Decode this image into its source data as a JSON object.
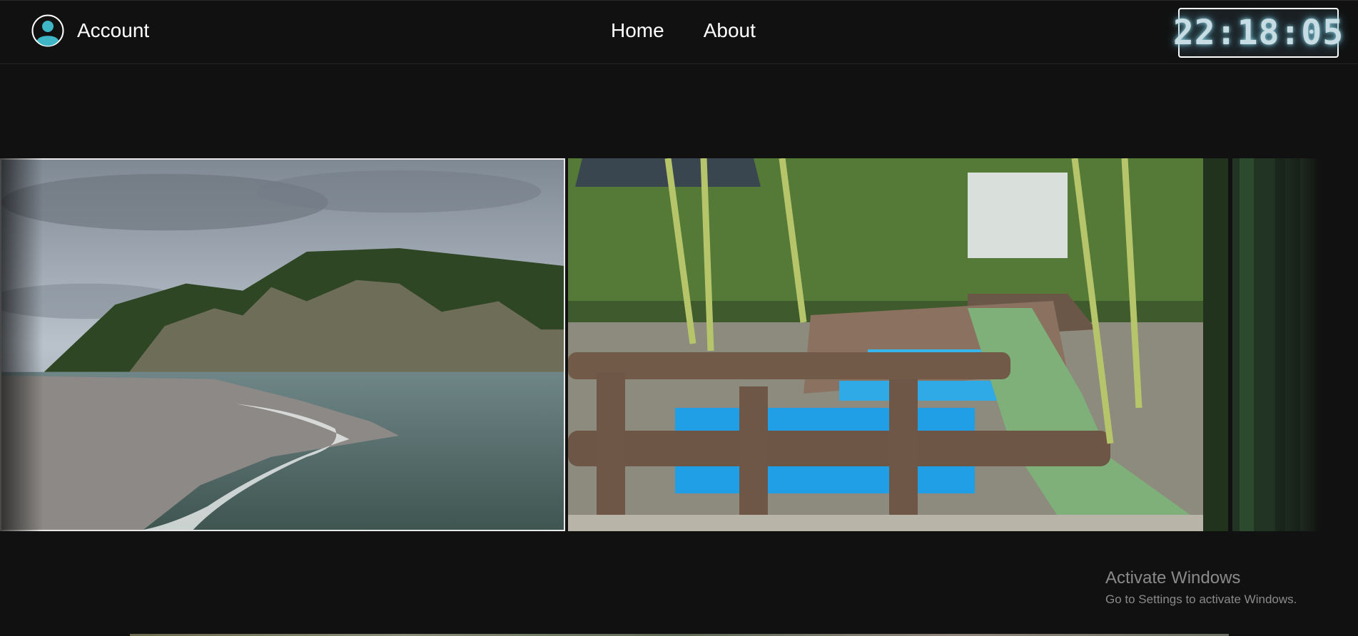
{
  "header": {
    "account_label": "Account",
    "account_icon": "user-avatar-icon",
    "nav": [
      {
        "label": "Home"
      },
      {
        "label": "About"
      }
    ],
    "clock": "22:18:05"
  },
  "carousel": {
    "slides": [
      {
        "subject": "beach"
      },
      {
        "subject": "hot-springs"
      },
      {
        "subject": "forest"
      }
    ]
  },
  "watermark": {
    "title": "Activate Windows",
    "subtitle": "Go to Settings to activate Windows."
  },
  "colors": {
    "background": "#111111",
    "avatar_accent": "#3fb6c6",
    "clock_glow": "#8fd0e2"
  }
}
